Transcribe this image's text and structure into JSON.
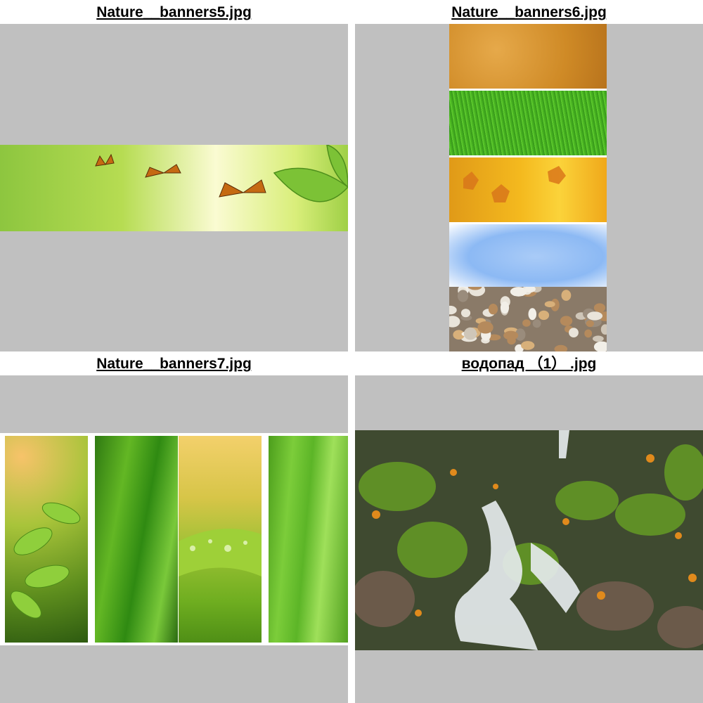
{
  "gallery": {
    "items": [
      {
        "caption": "Nature__banners5.jpg",
        "subject": "butterflies-banner"
      },
      {
        "caption": "Nature__banners6.jpg",
        "subject": "texture-strips-banner"
      },
      {
        "caption": "Nature__banners7.jpg",
        "subject": "green-leaves-panels"
      },
      {
        "caption": "водопад （1） .jpg",
        "subject": "autumn-waterfall"
      }
    ]
  },
  "colors": {
    "frame_background": "#c0c0c0",
    "page_background": "#ffffff",
    "caption_text": "#000000"
  }
}
